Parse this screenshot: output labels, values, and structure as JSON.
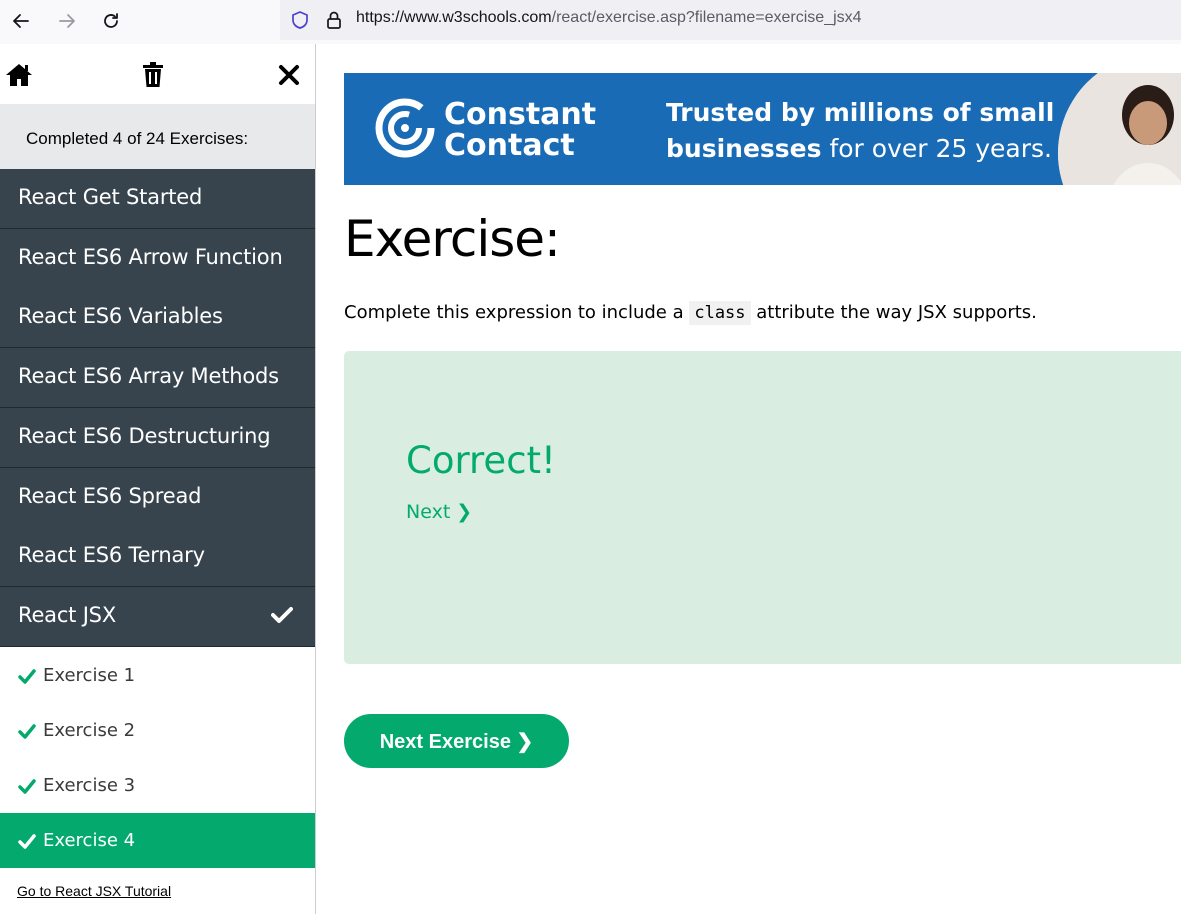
{
  "browser": {
    "url_host": "https://www.w3schools.com",
    "url_path": "/react/exercise.asp?filename=exercise_jsx4"
  },
  "sidebar": {
    "completed_text": "Completed 4 of 24 Exercises:",
    "topics": [
      {
        "label": "React Get Started"
      },
      {
        "label": "React ES6 Arrow Function"
      },
      {
        "label": "React ES6 Variables"
      },
      {
        "label": "React ES6 Array Methods"
      },
      {
        "label": "React ES6 Destructuring"
      },
      {
        "label": "React ES6 Spread"
      },
      {
        "label": "React ES6 Ternary"
      },
      {
        "label": "React JSX"
      }
    ],
    "exercises": [
      {
        "label": "Exercise 1"
      },
      {
        "label": "Exercise 2"
      },
      {
        "label": "Exercise 3"
      },
      {
        "label": "Exercise 4"
      }
    ],
    "tutorial_link": "Go to React JSX Tutorial"
  },
  "ad": {
    "brand_line1": "Constant",
    "brand_line2": "Contact",
    "tag_bold1": "Trusted by millions of small",
    "tag_bold2": "businesses",
    "tag_rest": " for over 25 years."
  },
  "main": {
    "heading": "Exercise:",
    "instruction_before": "Complete this expression to include a ",
    "instruction_code": "class",
    "instruction_after": " attribute the way JSX supports.",
    "result_title": "Correct!",
    "next_link": "Next ❯",
    "next_button": "Next Exercise ❯"
  },
  "colors": {
    "accent": "#04aa6d",
    "sidebar_dark": "#38444d",
    "result_bg": "#d9eee1",
    "ad_blue": "#1a6bb5"
  }
}
